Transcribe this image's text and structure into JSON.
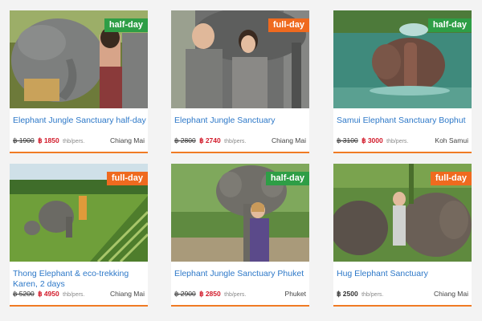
{
  "cards": [
    {
      "badge": "half-day",
      "badge_type": "half",
      "title": "Elephant Jungle Sanctuary half-day",
      "old_price": "฿ 1900",
      "price": "฿ 1850",
      "unit": "thb/pers.",
      "location": "Chiang Mai"
    },
    {
      "badge": "full-day",
      "badge_type": "full",
      "title": "Elephant Jungle Sanctuary",
      "old_price": "฿ 2800",
      "price": "฿ 2740",
      "unit": "thb/pers.",
      "location": "Chiang Mai"
    },
    {
      "badge": "half-day",
      "badge_type": "half",
      "title": "Samui Elephant Sanctuary Bophut",
      "old_price": "฿ 3100",
      "price": "฿ 3000",
      "unit": "thb/pers.",
      "location": "Koh Samui"
    },
    {
      "badge": "full-day",
      "badge_type": "full",
      "title": "Thong Elephant & eco-trekking Karen, 2 days",
      "old_price": "฿ 5200",
      "price": "฿ 4950",
      "unit": "thb/pers.",
      "location": "Chiang Mai"
    },
    {
      "badge": "half-day",
      "badge_type": "half",
      "title": "Elephant Jungle Sanctuary Phuket",
      "old_price": "฿ 2900",
      "price": "฿ 2850",
      "unit": "thb/pers.",
      "location": "Phuket"
    },
    {
      "badge": "full-day",
      "badge_type": "full",
      "title": "Hug Elephant Sanctuary",
      "old_price": "",
      "price": "฿ 2500",
      "unit": "thb/pers.",
      "location": "Chiang Mai"
    }
  ],
  "colors": {
    "half_badge": "#2e9e46",
    "full_badge": "#ef6a1f",
    "title": "#2d78c8",
    "price": "#d21b2b",
    "accent_border": "#f07b24"
  }
}
